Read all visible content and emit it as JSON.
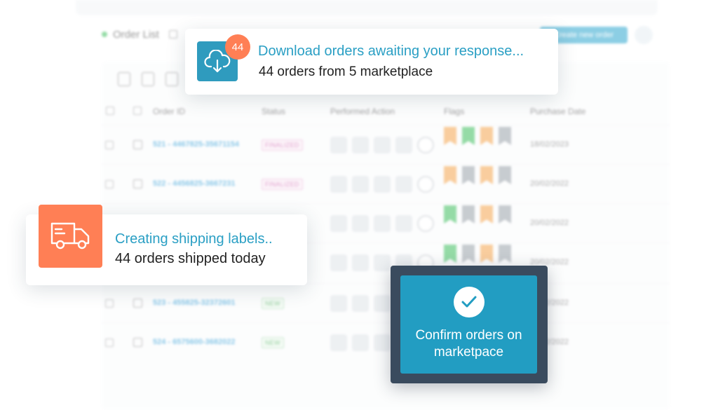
{
  "background_app": {
    "page_title": "Order List",
    "create_button_label": "Create new order",
    "table_headers": {
      "order_id": "Order ID",
      "status": "Status",
      "performed_action": "Performed Action",
      "flags": "Flags",
      "purchase_date": "Purchase Date"
    },
    "rows": [
      {
        "order_id": "521 - 4467825-35671154",
        "status": "FINALIZED",
        "status_kind": "finalized",
        "purchase_date": "18/02/2023",
        "flag_colors": [
          "#f5a64f",
          "#3fbf5f",
          "#f5a64f",
          "#9aa3aa"
        ]
      },
      {
        "order_id": "522 - 4456825-3667231",
        "status": "FINALIZED",
        "status_kind": "finalized",
        "purchase_date": "20/02/2022",
        "flag_colors": [
          "#f5a64f",
          "#9aa3aa",
          "#f5a64f",
          "#9aa3aa"
        ]
      },
      {
        "order_id": "",
        "status": "",
        "status_kind": "",
        "purchase_date": "20/02/2022",
        "flag_colors": [
          "#3fbf5f",
          "#9aa3aa",
          "#f5a64f",
          "#9aa3aa"
        ]
      },
      {
        "order_id": "",
        "status": "",
        "status_kind": "",
        "purchase_date": "20/02/2022",
        "flag_colors": [
          "#3fbf5f",
          "#9aa3aa",
          "#f5a64f",
          "#9aa3aa"
        ]
      },
      {
        "order_id": "523 - 455825-32372601",
        "status": "NEW",
        "status_kind": "new",
        "purchase_date": "20/02/2022",
        "flag_colors": []
      },
      {
        "order_id": "524 - 6575600-3682022",
        "status": "NEW",
        "status_kind": "new",
        "purchase_date": "20/02/2022",
        "flag_colors": []
      }
    ]
  },
  "download_card": {
    "badge_count": "44",
    "title": "Download orders awaiting your response...",
    "subtitle": "44 orders from 5 marketplace",
    "icon": "cloud-download-icon"
  },
  "shipping_card": {
    "title": "Creating shipping labels..",
    "subtitle": "44 orders shipped today",
    "icon": "truck-icon"
  },
  "confirm_card": {
    "text": "Confirm orders on marketpace",
    "icon": "check-icon"
  },
  "colors": {
    "accent_blue": "#2a9fc4",
    "accent_orange": "#ff7f55",
    "confirm_frame": "#3a4b5e",
    "confirm_inner": "#229dc2"
  }
}
